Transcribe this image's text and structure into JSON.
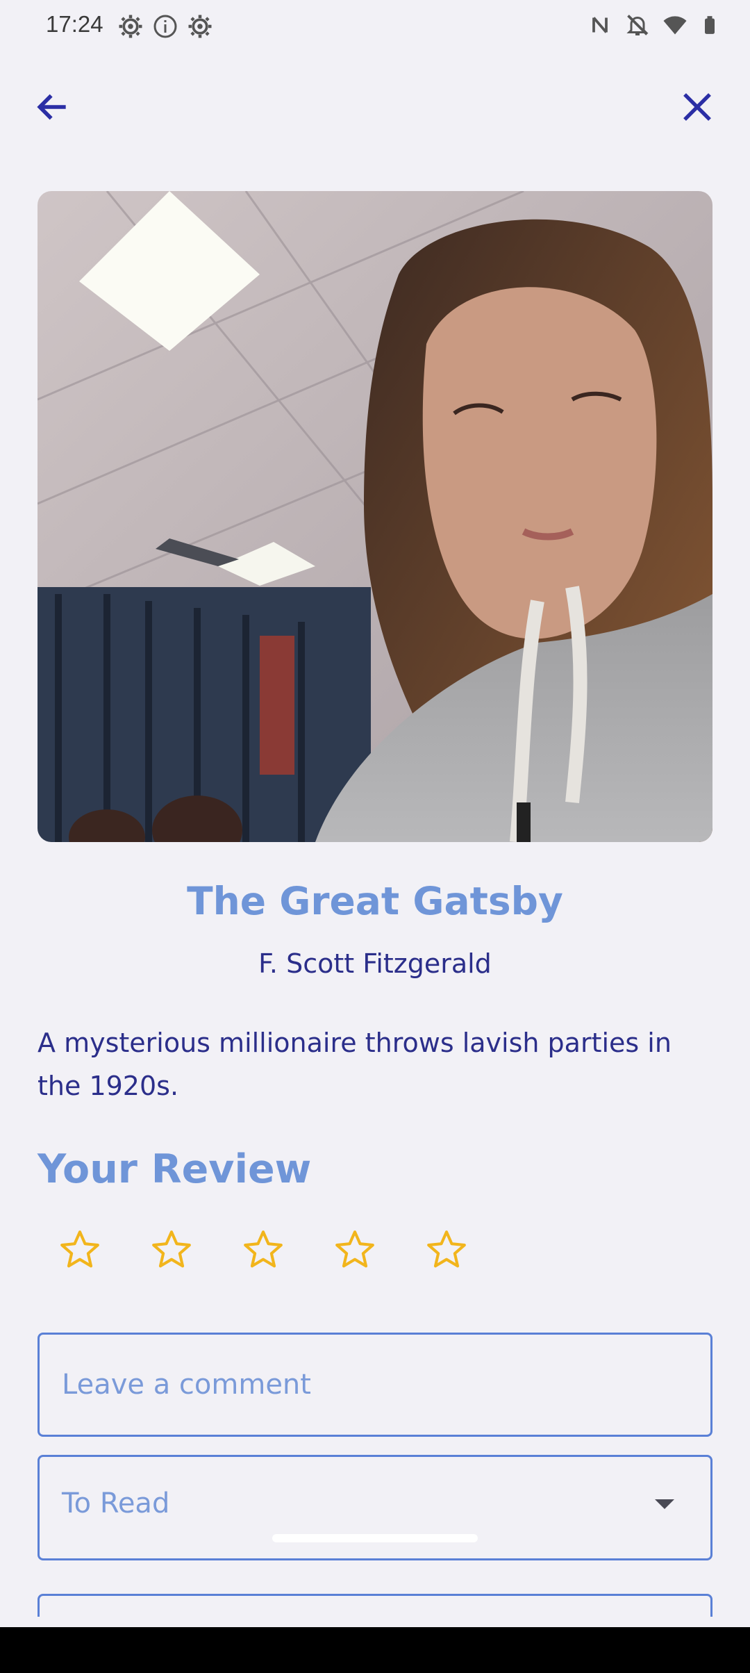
{
  "status_bar": {
    "time": "17:24",
    "left_icons": [
      "settings-gear-icon",
      "info-icon",
      "settings-gear-icon"
    ],
    "right_icons": [
      "nfc-icon",
      "bell-off-icon",
      "wifi-icon",
      "battery-icon"
    ]
  },
  "toolbar": {
    "back_icon": "arrow-left-icon",
    "close_icon": "close-icon",
    "icon_color": "#2b2ea5"
  },
  "book": {
    "title": "The Great Gatsby",
    "author": "F. Scott Fitzgerald",
    "description": "A mysterious millionaire throws lavish parties in the 1920s."
  },
  "review": {
    "heading": "Your Review",
    "rating": 0,
    "max_rating": 5,
    "star_color": "#f2b51c",
    "comment_placeholder": "Leave a comment",
    "comment_value": "",
    "status_selected": "To Read"
  },
  "colors": {
    "accent": "#6f95d8",
    "text": "#2b2e8a",
    "background": "#f2f1f6",
    "field_border": "#5a80d6"
  }
}
